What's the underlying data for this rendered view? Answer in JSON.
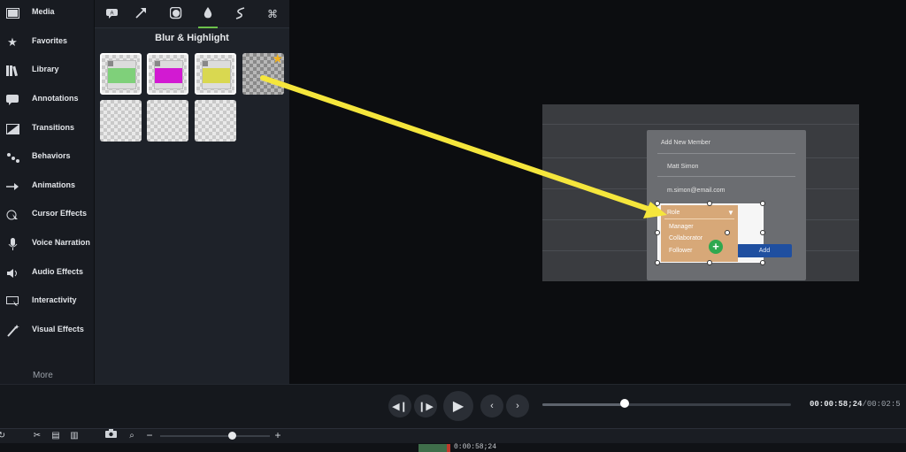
{
  "sidebar": {
    "items": [
      {
        "label": "Media",
        "icon": "film-strip-icon"
      },
      {
        "label": "Favorites",
        "icon": "star-icon"
      },
      {
        "label": "Library",
        "icon": "library-books-icon"
      },
      {
        "label": "Annotations",
        "icon": "speech-bubble-icon"
      },
      {
        "label": "Transitions",
        "icon": "transition-icon"
      },
      {
        "label": "Behaviors",
        "icon": "behaviors-dots-icon"
      },
      {
        "label": "Animations",
        "icon": "animation-arrow-icon"
      },
      {
        "label": "Cursor Effects",
        "icon": "cursor-effects-icon"
      },
      {
        "label": "Voice Narration",
        "icon": "microphone-icon"
      },
      {
        "label": "Audio Effects",
        "icon": "speaker-icon"
      },
      {
        "label": "Interactivity",
        "icon": "interactivity-icon"
      },
      {
        "label": "Visual Effects",
        "icon": "magic-wand-icon"
      }
    ],
    "more": "More"
  },
  "panel": {
    "title": "Blur & Highlight",
    "tabs": [
      "callout-icon",
      "arrow-icon",
      "shape-icon",
      "blur-drop-icon",
      "sketch-icon",
      "keystroke-icon"
    ],
    "active_tab": 3,
    "thumbnails": [
      {
        "name": "highlight-green",
        "color": "#7fd07a"
      },
      {
        "name": "highlight-magenta",
        "color": "#d21ad2"
      },
      {
        "name": "highlight-yellow",
        "color": "#d9d850"
      },
      {
        "name": "blur-favorite"
      },
      {
        "name": "blank-1"
      },
      {
        "name": "blank-2"
      },
      {
        "name": "blank-3"
      }
    ]
  },
  "preview": {
    "dialog_title": "Add New Member",
    "name_value": "Matt Simon",
    "email_value": "m.simon@email.com",
    "role_label": "Role",
    "role_options": [
      "Manager",
      "Collaborator",
      "Follower"
    ],
    "add_button": "Add"
  },
  "playback": {
    "timecode_current": "00:00:58;24",
    "timecode_total": "00:02:5",
    "progress": 0.33
  },
  "timeline": {
    "playhead_time": "0:00:58;24",
    "zoom_minus": "−",
    "zoom_plus": "+"
  },
  "colors": {
    "accent_green": "#6cc04a",
    "arrow_yellow": "#f5e63c",
    "favorite_star": "#f1b11b"
  }
}
